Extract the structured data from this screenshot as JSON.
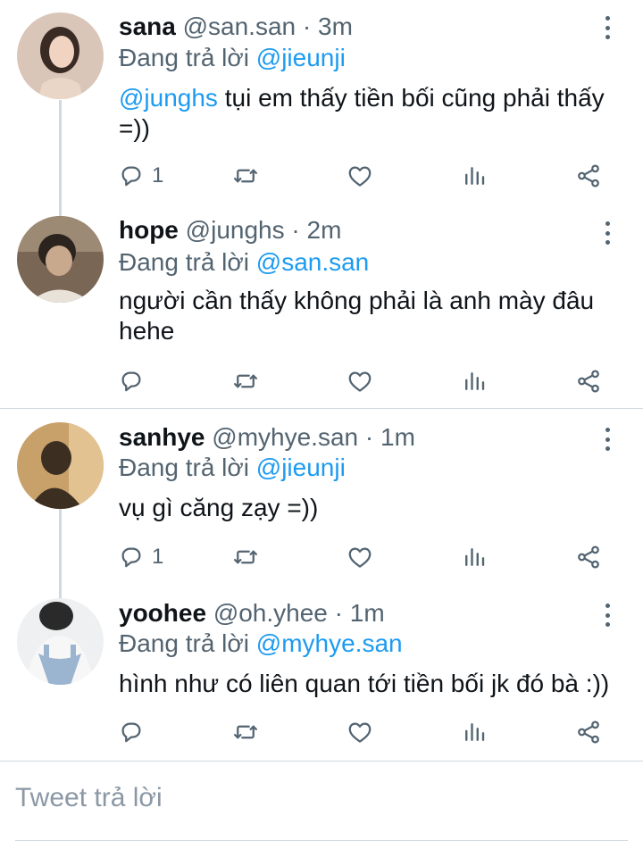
{
  "replying_prefix": "Đang trả lời",
  "replies": [
    {
      "name": "sana",
      "handle": "@san.san",
      "separator": "·",
      "time": "3m",
      "reply_to": "@jieunji",
      "mention": "@junghs",
      "text": " tụi em thấy tiền bối cũng phải thấy =))",
      "reply_count": "1"
    },
    {
      "name": "hope",
      "handle": "@junghs",
      "separator": "·",
      "time": "2m",
      "reply_to": "@san.san",
      "mention": "",
      "text": "người cần thấy không phải là anh mày đâu hehe",
      "reply_count": ""
    },
    {
      "name": "sanhye",
      "handle": "@myhye.san",
      "separator": "·",
      "time": "1m",
      "reply_to": "@jieunji",
      "mention": "",
      "text": "vụ gì căng zạy =))",
      "reply_count": "1"
    },
    {
      "name": "yoohee",
      "handle": "@oh.yhee",
      "separator": "·",
      "time": "1m",
      "reply_to": "@myhye.san",
      "mention": "",
      "text": "hình như có liên quan tới tiền bối jk đó bà :))",
      "reply_count": ""
    }
  ],
  "composer": {
    "placeholder": "Tweet trả lời"
  },
  "colors": {
    "accent": "#1d9bf0",
    "muted": "#536471",
    "text": "#0f1419",
    "border": "#cfd9de"
  },
  "icons": [
    "reply-icon",
    "retweet-icon",
    "like-icon",
    "views-icon",
    "share-icon",
    "more-icon"
  ]
}
